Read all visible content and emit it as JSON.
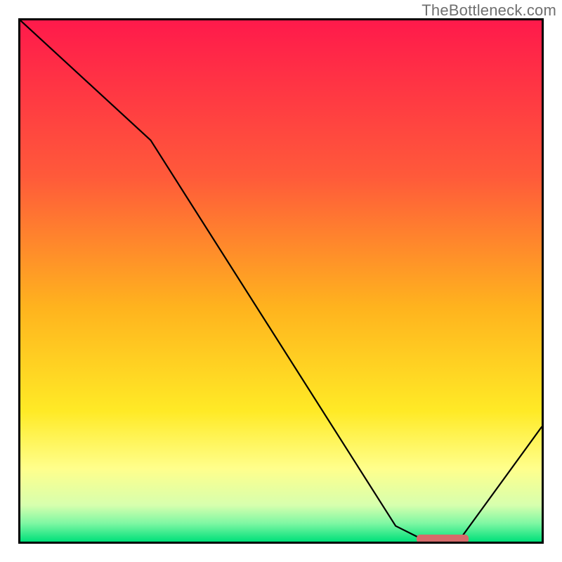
{
  "watermark": "TheBottleneck.com",
  "chart_data": {
    "type": "line",
    "title": "",
    "xlabel": "",
    "ylabel": "",
    "xlim": [
      0,
      100
    ],
    "ylim": [
      0,
      100
    ],
    "grid": false,
    "legend": false,
    "background_gradient": {
      "stops": [
        {
          "offset": 0.0,
          "color": "#ff1a4b"
        },
        {
          "offset": 0.3,
          "color": "#ff5a3a"
        },
        {
          "offset": 0.55,
          "color": "#ffb31e"
        },
        {
          "offset": 0.75,
          "color": "#ffea26"
        },
        {
          "offset": 0.86,
          "color": "#ffff8c"
        },
        {
          "offset": 0.93,
          "color": "#d7ffae"
        },
        {
          "offset": 0.965,
          "color": "#7ef7a3"
        },
        {
          "offset": 1.0,
          "color": "#00e07a"
        }
      ]
    },
    "series": [
      {
        "name": "bottleneck-curve",
        "x": [
          0,
          25,
          72,
          78,
          84,
          100
        ],
        "y": [
          100,
          77,
          3,
          0,
          0,
          22
        ]
      }
    ],
    "marker": {
      "name": "optimal-range",
      "x_start": 76,
      "x_end": 86,
      "y": 0,
      "color": "#d56a6a"
    }
  }
}
